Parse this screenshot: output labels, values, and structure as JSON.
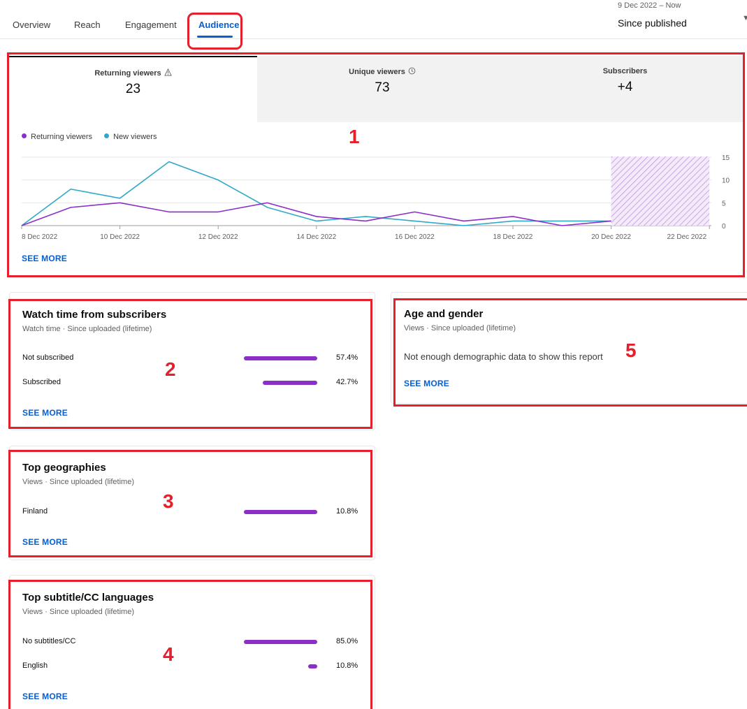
{
  "tabs": [
    {
      "label": "Overview",
      "active": false
    },
    {
      "label": "Reach",
      "active": false
    },
    {
      "label": "Engagement",
      "active": false
    },
    {
      "label": "Audience",
      "active": true
    }
  ],
  "date_range": {
    "range": "9 Dec 2022 – Now",
    "label": "Since published"
  },
  "metrics": [
    {
      "label": "Returning viewers",
      "value": "23",
      "icon": "warning-icon"
    },
    {
      "label": "Unique viewers",
      "value": "73",
      "icon": "clock-icon"
    },
    {
      "label": "Subscribers",
      "value": "+4"
    }
  ],
  "colors": {
    "returning": "#8c2fc8",
    "new": "#2fa8c9",
    "accent": "#065fd4",
    "annotation": "#e3202b"
  },
  "chart_data": {
    "type": "line",
    "x": [
      "8 Dec 2022",
      "9 Dec 2022",
      "10 Dec 2022",
      "11 Dec 2022",
      "12 Dec 2022",
      "13 Dec 2022",
      "14 Dec 2022",
      "15 Dec 2022",
      "16 Dec 2022",
      "17 Dec 2022",
      "18 Dec 2022",
      "19 Dec 2022",
      "20 Dec 2022"
    ],
    "x_tick_labels": [
      "8 Dec 2022",
      "10 Dec 2022",
      "12 Dec 2022",
      "14 Dec 2022",
      "16 Dec 2022",
      "18 Dec 2022",
      "20 Dec 2022",
      "22 Dec 2022"
    ],
    "series": [
      {
        "name": "Returning viewers",
        "values": [
          0,
          4,
          5,
          3,
          3,
          5,
          2,
          1,
          3,
          1,
          2,
          0,
          1
        ]
      },
      {
        "name": "New viewers",
        "values": [
          0,
          8,
          6,
          14,
          10,
          4,
          1,
          2,
          1,
          0,
          1,
          1,
          1
        ]
      }
    ],
    "y_ticks": [
      0,
      5,
      10,
      15
    ],
    "ylim": [
      0,
      15
    ],
    "shaded_region": [
      "20 Dec 2022",
      "22 Dec 2022"
    ],
    "grid": true,
    "legend_position": "top-left"
  },
  "see_more": "SEE MORE",
  "subscribers_card": {
    "title": "Watch time from subscribers",
    "subtitle": "Watch time · Since uploaded (lifetime)",
    "rows": [
      {
        "label": "Not subscribed",
        "percent": "57.4%",
        "value": 57.4
      },
      {
        "label": "Subscribed",
        "percent": "42.7%",
        "value": 42.7
      }
    ]
  },
  "geo_card": {
    "title": "Top geographies",
    "subtitle": "Views · Since uploaded (lifetime)",
    "rows": [
      {
        "label": "Finland",
        "percent": "10.8%",
        "value": 10.8
      }
    ]
  },
  "subtitle_card": {
    "title": "Top subtitle/CC languages",
    "subtitle": "Views · Since uploaded (lifetime)",
    "rows": [
      {
        "label": "No subtitles/CC",
        "percent": "85.0%",
        "value": 85.0
      },
      {
        "label": "English",
        "percent": "10.8%",
        "value": 10.8
      }
    ]
  },
  "age_card": {
    "title": "Age and gender",
    "subtitle": "Views · Since uploaded (lifetime)",
    "message": "Not enough demographic data to show this report"
  },
  "annotations": [
    "1",
    "2",
    "3",
    "4",
    "5"
  ]
}
